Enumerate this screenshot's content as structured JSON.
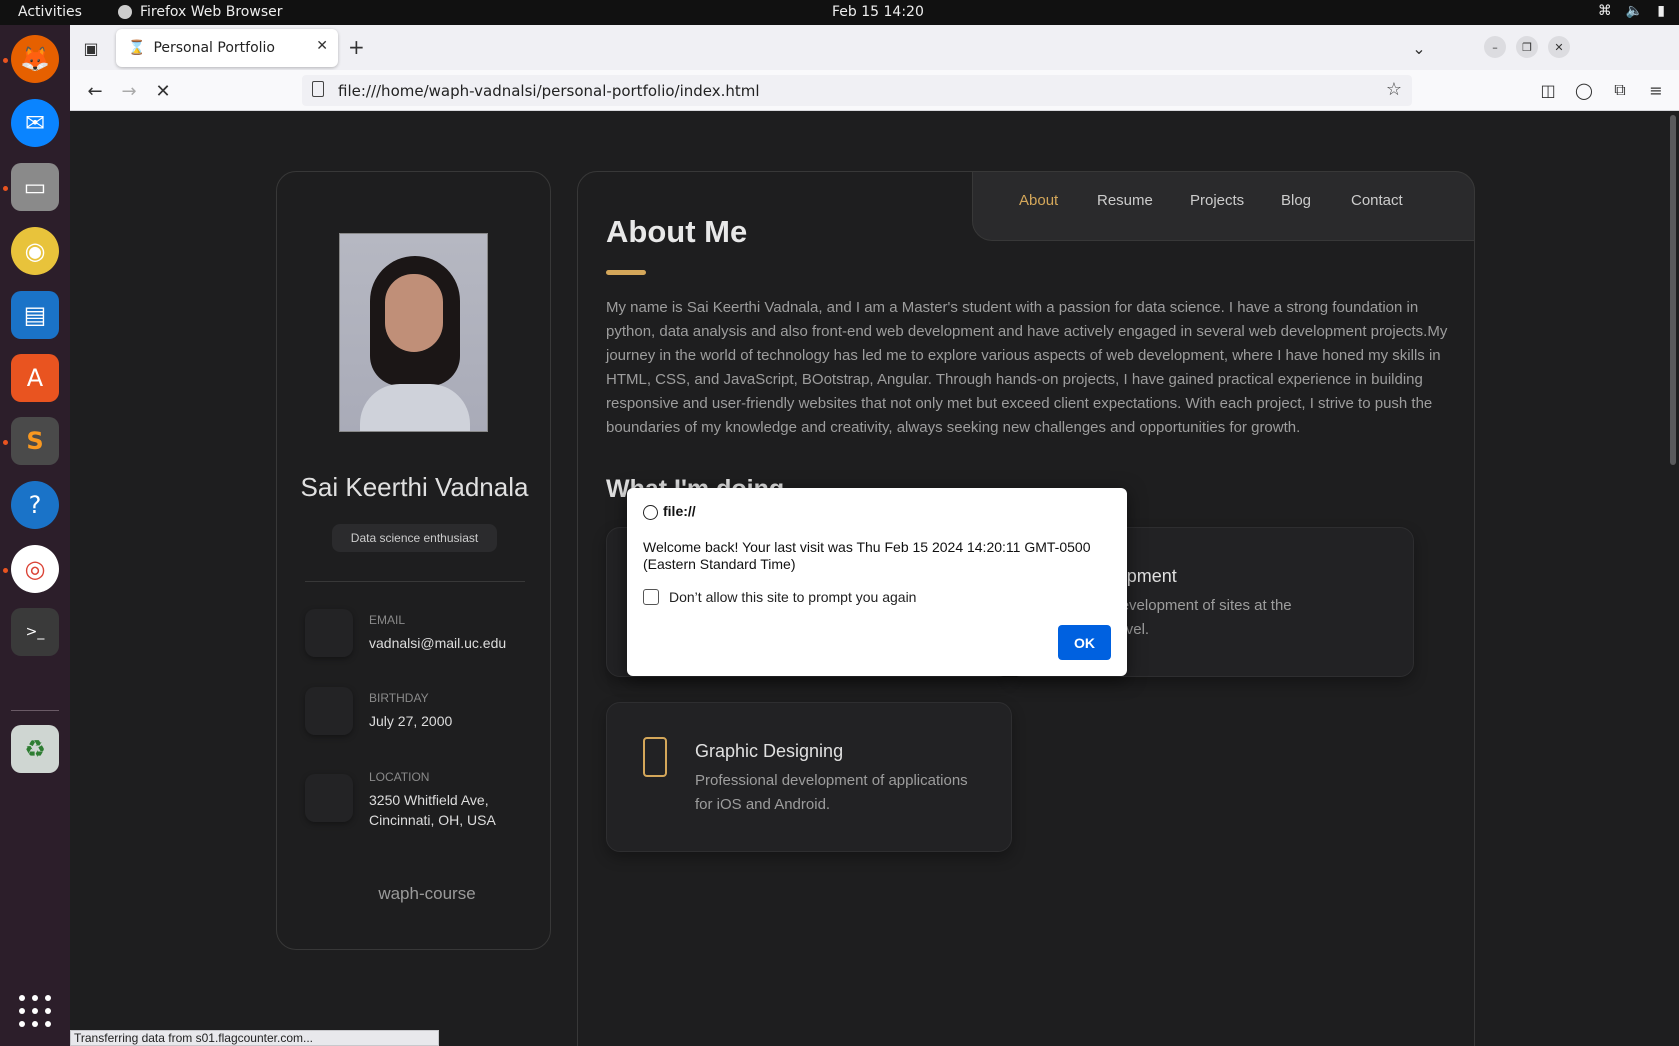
{
  "topbar": {
    "activities": "Activities",
    "app_name": "Firefox Web Browser",
    "clock": "Feb 15  14:20"
  },
  "dock": {
    "items": [
      "firefox-icon",
      "thunderbird-icon",
      "files-icon",
      "rhythmbox-icon",
      "writer-icon",
      "app-center-icon",
      "sublime-text-icon",
      "help-icon",
      "chrome-icon",
      "terminal-icon",
      "trash-icon"
    ]
  },
  "browser": {
    "tab_title": "Personal Portfolio",
    "url": "file:///home/waph-vadnalsi/personal-portfolio/index.html",
    "status": "Transferring data from s01.flagcounter.com..."
  },
  "sidebar": {
    "name": "Sai Keerthi Vadnala",
    "title": "Data science enthusiast",
    "contacts": [
      {
        "label": "Email",
        "value": "vadnalsi@mail.uc.edu"
      },
      {
        "label": "Birthday",
        "value": "July 27, 2000"
      },
      {
        "label": "Location",
        "value": "3250 Whitfield Ave, Cincinnati, OH, USA"
      }
    ],
    "footer": "waph-course"
  },
  "main": {
    "nav": [
      "About",
      "Resume",
      "Projects",
      "Blog",
      "Contact"
    ],
    "active_nav": "About",
    "heading": "About Me",
    "about_text": "My name is Sai Keerthi Vadnala, and I am a Master's student with a passion for data science. I have a strong foundation in python, data analysis and also front-end web development and have actively engaged in several web development projects.My journey in the world of technology has led me to explore various aspects of web development, where I have honed my skills in HTML, CSS, and JavaScript, BOotstrap, Angular. Through hands-on projects, I have gained practical experience in building responsive and user-friendly websites that not only met but exceed client expectations. With each project, I strive to push the boundaries of my knowledge and creativity, always seeking new challenges and opportunities for growth.",
    "whatim_heading": "What I'm doing",
    "services": [
      {
        "title": "Web Development",
        "desc": "High-quality development of sites at the professional level."
      },
      {
        "title": "Graphic Designing",
        "desc": "Professional development of applications for iOS and Android."
      }
    ]
  },
  "dialog": {
    "origin": "file://",
    "message": "Welcome back! Your last visit was Thu Feb 15 2024 14:20:11 GMT-0500 (Eastern Standard Time)",
    "checkbox_label": "Don’t allow this site to prompt you again",
    "ok_label": "OK"
  },
  "colors": {
    "accent": "#d4a75a",
    "page_bg": "#1e1e1f",
    "dialog_button": "#0061e0"
  }
}
